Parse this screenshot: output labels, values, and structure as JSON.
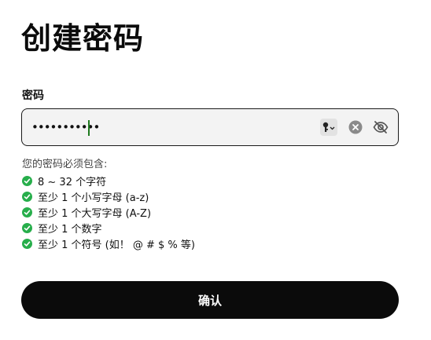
{
  "page": {
    "title": "创建密码"
  },
  "password_field": {
    "label": "密码",
    "masked_value": "•••••••••••"
  },
  "requirements": {
    "intro": "您的密码必须包含:",
    "items": [
      {
        "text": "8 ~ 32 个字符",
        "met": true
      },
      {
        "text": "至少 1 个小写字母 (a-z)",
        "met": true
      },
      {
        "text": "至少 1 个大写字母 (A-Z)",
        "met": true
      },
      {
        "text": "至少 1 个数字",
        "met": true
      },
      {
        "text": "至少 1 个符号 (如！ @ # $ % 等)",
        "met": true
      }
    ]
  },
  "confirm_button": {
    "label": "确认"
  },
  "colors": {
    "check": "#27ae4b",
    "button_bg": "#0b0b0b",
    "caret": "#1e7a1e"
  }
}
